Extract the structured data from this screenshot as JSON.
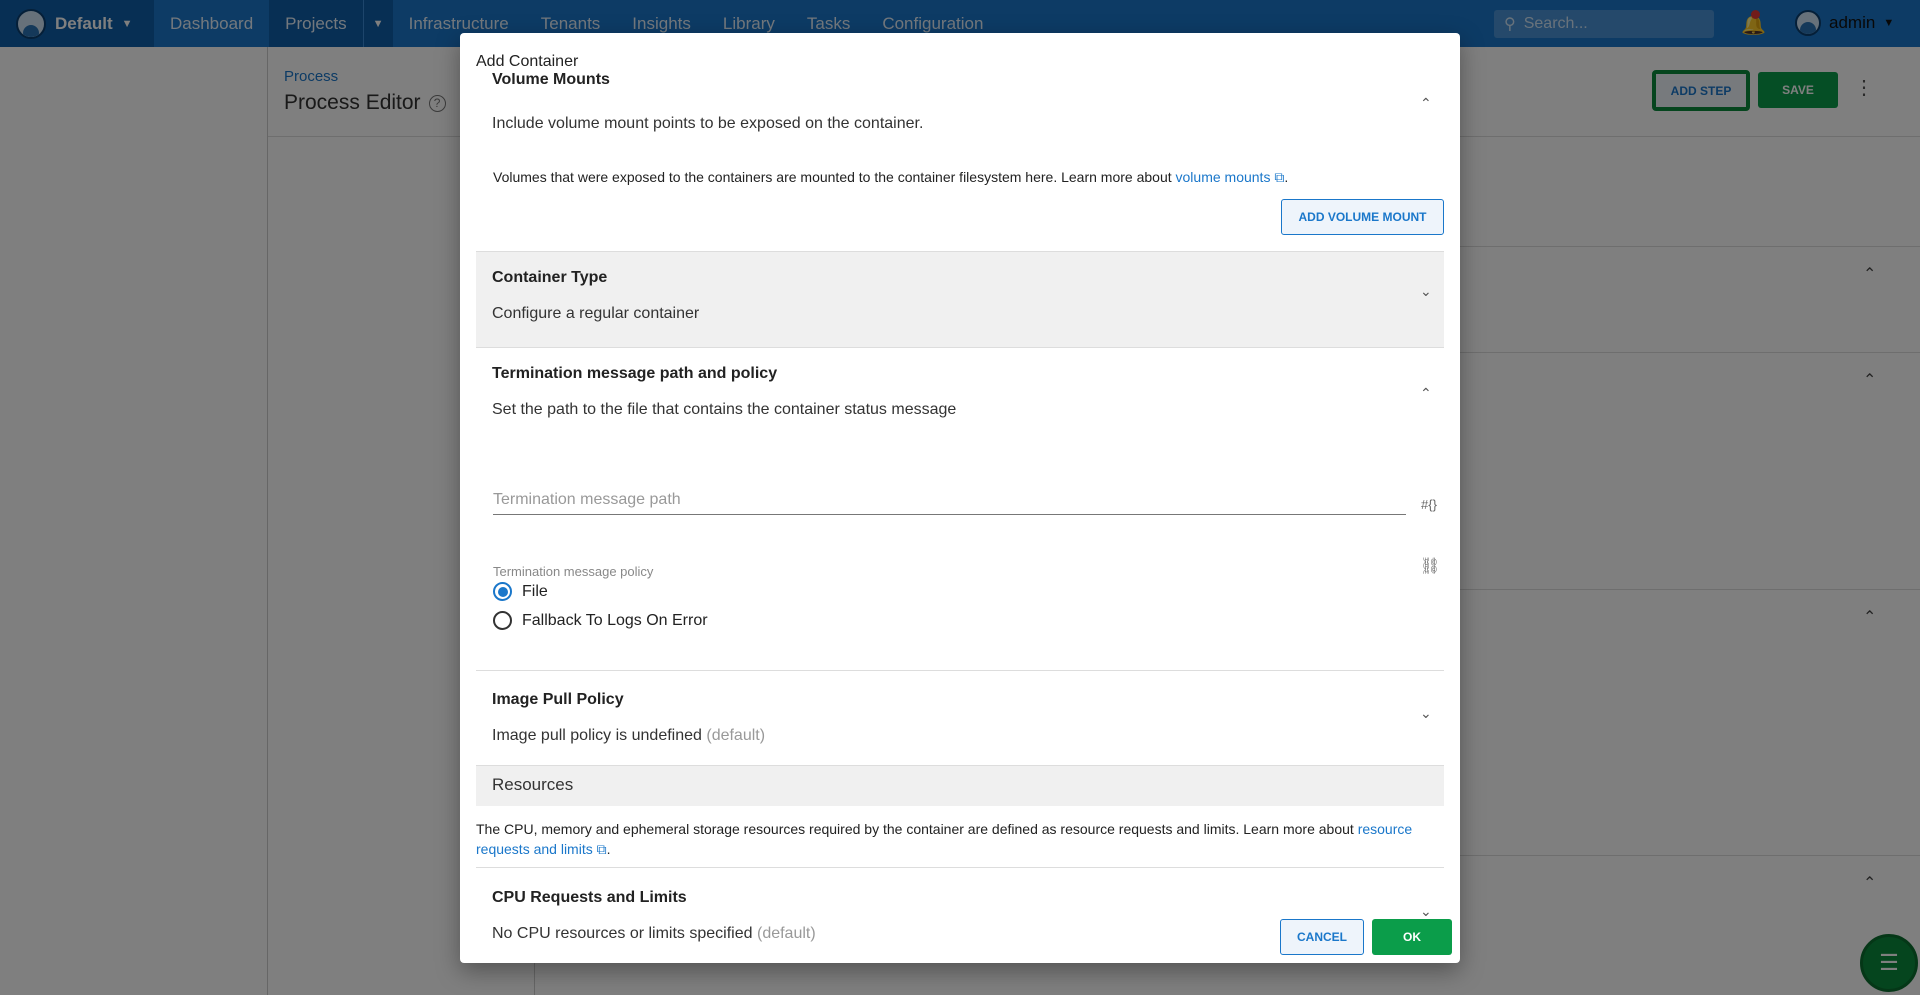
{
  "topnav": {
    "space": "Default",
    "items": [
      "Dashboard",
      "Projects",
      "Infrastructure",
      "Tenants",
      "Insights",
      "Library",
      "Tasks",
      "Configuration"
    ],
    "search_placeholder": "Search...",
    "user": "admin"
  },
  "page": {
    "breadcrumb": "Process",
    "title": "Process Editor",
    "add_step": "ADD STEP",
    "save": "SAVE"
  },
  "modal": {
    "title": "Add Container",
    "volume_mounts": {
      "title": "Volume Mounts",
      "summary": "Include volume mount points to be exposed on the container.",
      "help": "Volumes that were exposed to the containers are mounted to the container filesystem here. Learn more about ",
      "help_link": "volume mounts",
      "button": "ADD VOLUME MOUNT"
    },
    "container_type": {
      "title": "Container Type",
      "summary": "Configure a regular container"
    },
    "termination": {
      "title": "Termination message path and policy",
      "summary": "Set the path to the file that contains the container status message",
      "path_placeholder": "Termination message path",
      "policy_label": "Termination message policy",
      "options": [
        "File",
        "Fallback To Logs On Error"
      ],
      "selected": "File"
    },
    "image_pull": {
      "title": "Image Pull Policy",
      "summary": "Image pull policy is undefined",
      "default_tag": "(default)"
    },
    "resources": {
      "header": "Resources",
      "text": "The CPU, memory and ephemeral storage resources required by the container are defined as resource requests and limits. Learn more about ",
      "link": "resource requests and limits"
    },
    "cpu": {
      "title": "CPU Requests and Limits",
      "summary": "No CPU resources or limits specified",
      "default_tag": "(default)"
    },
    "cancel": "CANCEL",
    "ok": "OK"
  }
}
